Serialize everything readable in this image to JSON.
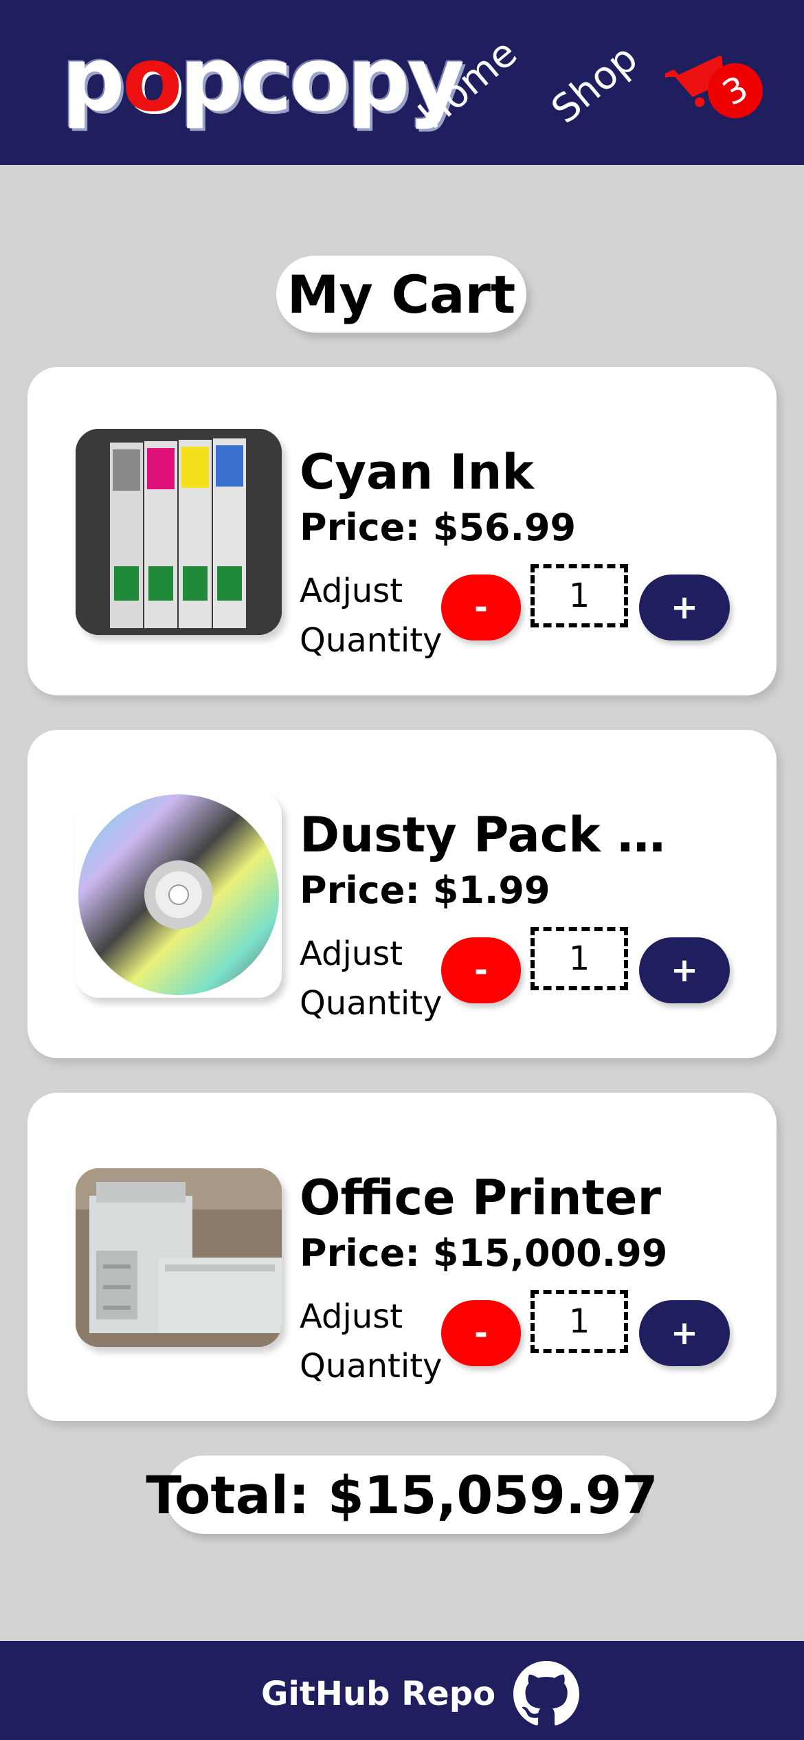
{
  "header": {
    "logo": {
      "part1": "p",
      "accent": "o",
      "part2": "pcopy"
    },
    "nav": {
      "home_label": "Home",
      "shop_label": "Shop"
    },
    "cart_icon": "cart-icon",
    "cart_count": "3"
  },
  "page_title": "My Cart",
  "cart_items": [
    {
      "name": "Cyan Ink",
      "price": "Price: $56.99",
      "adjust_label": "Adjust Quantity",
      "quantity": "1",
      "minus_label": "-",
      "plus_label": "+",
      "image": "ink-cartridges-image"
    },
    {
      "name": "Dusty Pack of ...",
      "price": "Price: $1.99",
      "adjust_label": "Adjust Quantity",
      "quantity": "1",
      "minus_label": "-",
      "plus_label": "+",
      "image": "cd-disc-image"
    },
    {
      "name": "Office Printer",
      "price": "Price: $15,000.99",
      "adjust_label": "Adjust Quantity",
      "quantity": "1",
      "minus_label": "-",
      "plus_label": "+",
      "image": "office-printer-image"
    }
  ],
  "total": "Total: $15,059.97",
  "footer": {
    "link_label": "GitHub Repo",
    "icon": "github-icon"
  },
  "colors": {
    "navy": "#1f1f5f",
    "red": "#ff0000",
    "background": "#d3d3d3",
    "white": "#ffffff"
  }
}
